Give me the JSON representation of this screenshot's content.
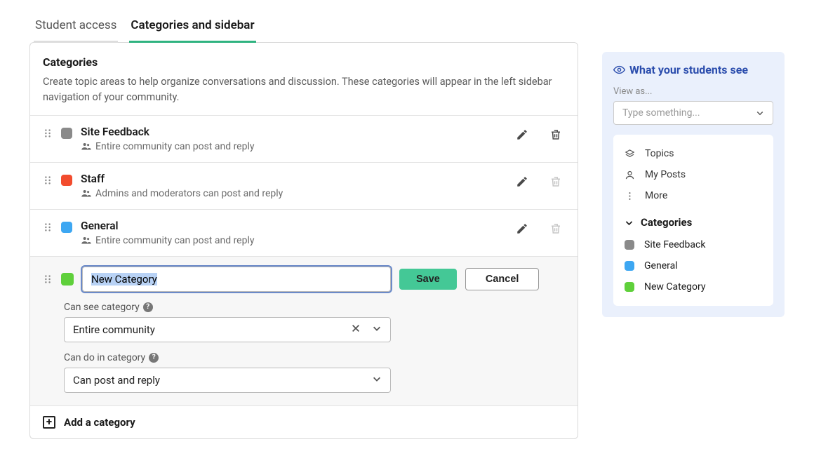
{
  "tabs": {
    "student_access": "Student access",
    "categories_sidebar": "Categories and sidebar"
  },
  "card": {
    "title": "Categories",
    "desc": "Create topic areas to help organize conversations and discussion. These categories will appear in the left sidebar navigation of your community."
  },
  "categories": [
    {
      "name": "Site Feedback",
      "perm": "Entire community can post and reply",
      "color": "#8a8a8a",
      "delete_enabled": true
    },
    {
      "name": "Staff",
      "perm": "Admins and moderators can post and reply",
      "color": "#f24c2e",
      "delete_enabled": false
    },
    {
      "name": "General",
      "perm": "Entire community can post and reply",
      "color": "#3da7f2",
      "delete_enabled": false
    }
  ],
  "editing": {
    "color": "#5fd03b",
    "name_value": "New Category",
    "save": "Save",
    "cancel": "Cancel",
    "can_see_label": "Can see category",
    "can_see_value": "Entire community",
    "can_do_label": "Can do in category",
    "can_do_value": "Can post and reply"
  },
  "add_label": "Add a category",
  "side": {
    "title": "What your students see",
    "view_as": "View as...",
    "view_placeholder": "Type something...",
    "nav": {
      "topics": "Topics",
      "my_posts": "My Posts",
      "more": "More"
    },
    "cat_header": "Categories",
    "preview_categories": [
      {
        "name": "Site Feedback",
        "color": "#8a8a8a"
      },
      {
        "name": "General",
        "color": "#3da7f2"
      },
      {
        "name": "New Category",
        "color": "#5fd03b"
      }
    ]
  }
}
